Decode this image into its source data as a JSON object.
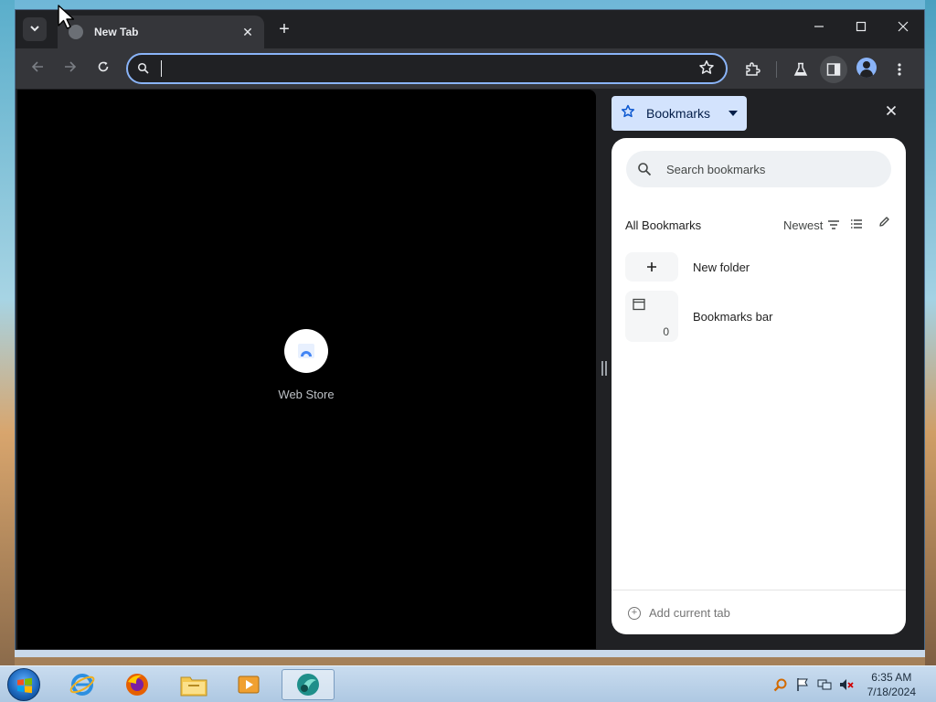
{
  "browser": {
    "tab": {
      "title": "New Tab",
      "close_glyph": "✕"
    },
    "new_tab_glyph": "+",
    "window_controls": {
      "minimize": "—",
      "maximize": "☐",
      "close": "✕"
    },
    "omnibox": {
      "value": "",
      "placeholder": ""
    },
    "toolbar_icons": [
      "back-arrow-icon",
      "forward-arrow-icon",
      "reload-icon",
      "star-icon",
      "extensions-icon",
      "labs-icon",
      "side-panel-icon",
      "profile-icon",
      "menu-icon"
    ]
  },
  "new_tab_page": {
    "shortcut": {
      "label": "Web Store"
    }
  },
  "side_panel": {
    "title": "Bookmarks",
    "search_placeholder": "Search bookmarks",
    "all_bookmarks_label": "All Bookmarks",
    "sort_label": "Newest",
    "items": [
      {
        "label": "New folder",
        "icon": "plus-icon",
        "count": ""
      },
      {
        "label": "Bookmarks bar",
        "icon": "folder-icon",
        "count": "0"
      }
    ],
    "footer_label": "Add current tab"
  },
  "taskbar": {
    "apps": [
      "internet-explorer-icon",
      "firefox-icon",
      "file-explorer-icon",
      "media-player-icon",
      "browser-app-icon"
    ],
    "clock": {
      "time": "6:35 AM",
      "date": "7/18/2024"
    }
  },
  "colors": {
    "accent": "#8ab4f8",
    "toolbar": "#35363a",
    "titlebar": "#202124",
    "panel_header": "#d3e3fd"
  }
}
